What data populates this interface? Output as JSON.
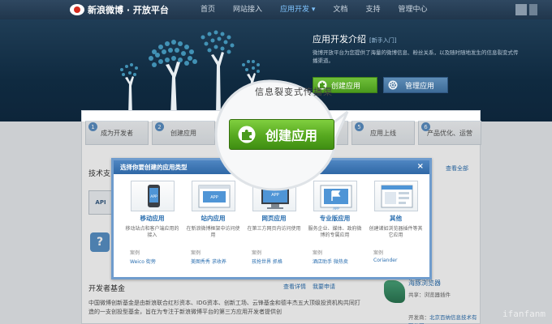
{
  "topnav": {
    "brand": "新浪微博 · 开放平台",
    "links": [
      "首页",
      "网站接入",
      "应用开发 ▾",
      "文档",
      "支持",
      "管理中心"
    ]
  },
  "hero": {
    "title": "应用开发介绍",
    "subtitle": "[新手入门]",
    "desc": "微博开放平台为您提供了海量的微博信息、粉丝关系，以及随时随地发生的信息裂变式传播渠道。",
    "create_label": "创建应用",
    "manage_label": "管理应用"
  },
  "steps": [
    {
      "num": "1",
      "label": "成为开发者"
    },
    {
      "num": "2",
      "label": "创建应用"
    },
    {
      "num": "3",
      "label": ""
    },
    {
      "num": "4",
      "label": ""
    },
    {
      "num": "5",
      "label": "应用上线"
    },
    {
      "num": "6",
      "label": "产品优化、运营"
    }
  ],
  "main": {
    "section_label": "技术支",
    "see_all": "查看全部",
    "api_label": "API",
    "fund_title": "开发者基金",
    "fund_links": [
      "查看详情",
      "我要申请"
    ],
    "fund_text": "中国微博创新基金是由新浪联合红杉资本、IDG资本、创新工场、云锋基金和德丰杰五大顶级投资机构共同打造的一支创投型基金，旨在为专注于新浪微博平台的第三方应用开发者提供创"
  },
  "browser": {
    "name": "海豚浏览器",
    "line1": "共享：浏览器插件",
    "dev_label": "开发商：",
    "dev_name": "北京百纳信息技术有限公司"
  },
  "modal": {
    "title": "选择你要创建的应用类型",
    "close": "×",
    "types": [
      {
        "name": "移动应用",
        "desc": "移动站点和客户端应用的接入",
        "case": "案例",
        "examples": "Weico  街旁",
        "icon": "mobile-app-icon"
      },
      {
        "name": "站内应用",
        "desc": "在新浪微博框架中访问使用",
        "case": "案例",
        "examples": "美图秀秀  求收养",
        "icon": "in-site-app-icon"
      },
      {
        "name": "网页应用",
        "desc": "在第三方网页内访问使用",
        "case": "案例",
        "examples": "孩抢世界  抓格",
        "icon": "web-app-icon"
      },
      {
        "name": "专业版应用",
        "desc": "服务企业、媒体、政府微博的专属应用",
        "case": "案例",
        "examples": "酒店助手  微热卖",
        "icon": "pro-app-icon"
      },
      {
        "name": "其他",
        "desc": "创建诸如浏览器插件等其它应用",
        "case": "案例",
        "examples": "Coriander",
        "icon": "other-app-icon"
      }
    ]
  },
  "magnifier": {
    "text": "信息裂变式传播渠",
    "button_label": "创建应用"
  },
  "watermark": "ifanfanm",
  "colors": {
    "nav_bg": "#20364c",
    "hero_bg": "#0f2a40",
    "green": "#56a81f",
    "blue": "#2b6fb0"
  }
}
